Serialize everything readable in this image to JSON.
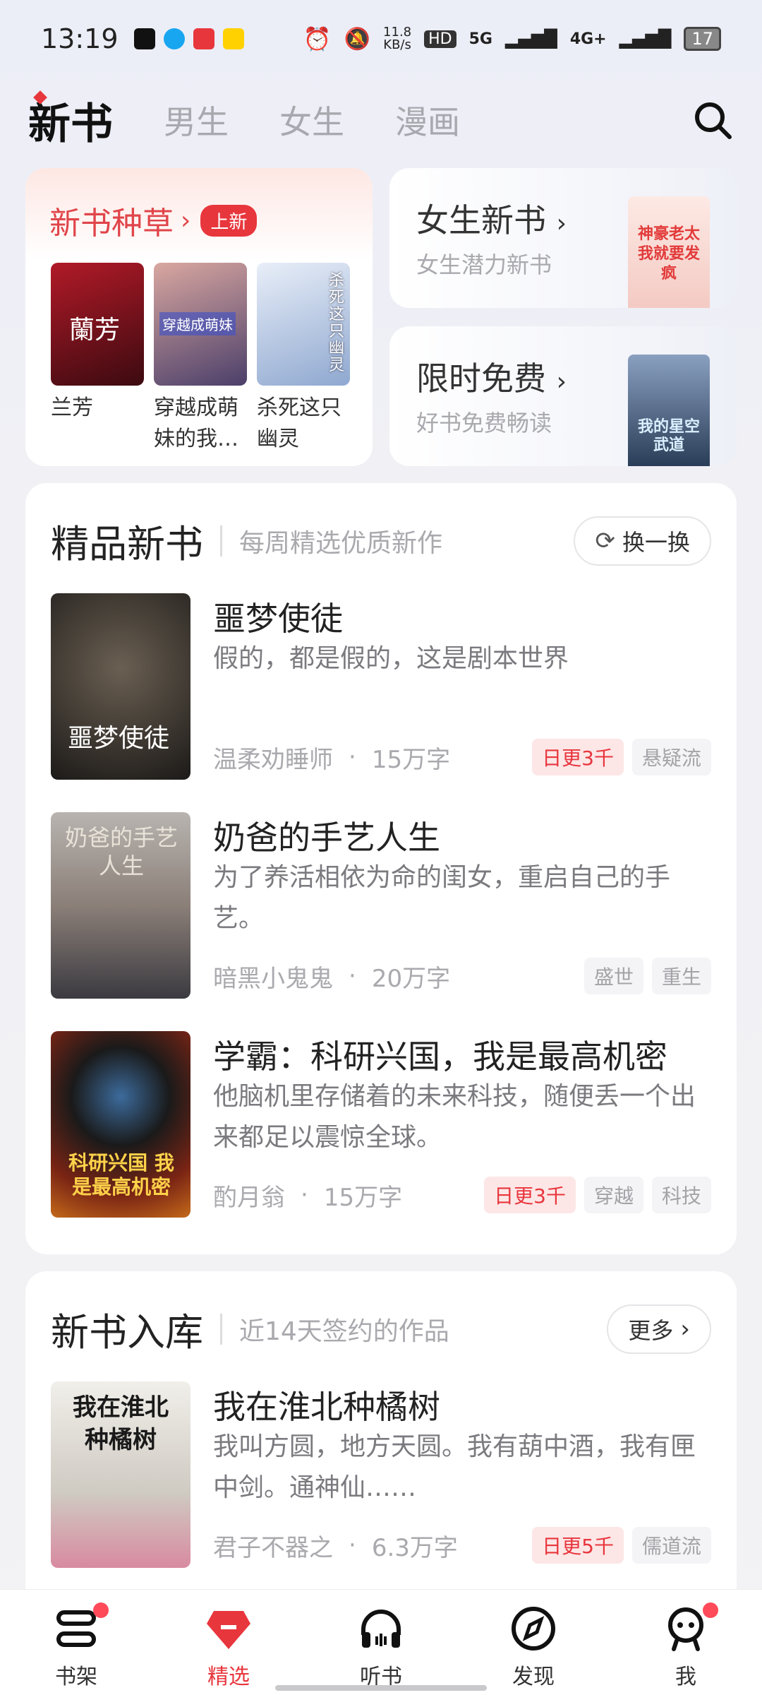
{
  "status_bar": {
    "time": "13:19",
    "net_speed": "11.8\nKB/s",
    "hd": "HD",
    "signal1": "5G",
    "signal2": "4G+",
    "battery": "17"
  },
  "top_nav": {
    "tabs": [
      "新书",
      "男生",
      "女生",
      "漫画"
    ],
    "active": "新书",
    "search_icon": "search-icon"
  },
  "promo_left": {
    "title": "新书种草",
    "badge": "上新",
    "books": [
      {
        "title": "兰芳",
        "cover_text": "蘭芳",
        "color": "#8b1420"
      },
      {
        "title": "穿越成萌妹的我…",
        "cover_text": "穿越成萌妹",
        "color": "#5a4a7a"
      },
      {
        "title": "杀死这只幽灵",
        "cover_text": "杀死这只幽灵",
        "color": "#9fb6d9"
      }
    ]
  },
  "promo_right": [
    {
      "title": "女生新书",
      "subtitle": "女生潜力新书",
      "cover_text": "神豪老太 我就要发疯",
      "color": "#f6d4cf"
    },
    {
      "title": "限时免费",
      "subtitle": "好书免费畅读",
      "cover_text": "我的星空武道",
      "color": "#3b4f73"
    }
  ],
  "premium": {
    "title": "精品新书",
    "subtitle": "每周精选优质新作",
    "refresh_label": "换一换",
    "books": [
      {
        "title": "噩梦使徒",
        "desc": "假的，都是假的，这是剧本世界",
        "author": "温柔劝睡师",
        "words": "15万字",
        "tags": [
          {
            "text": "日更3千",
            "hot": true
          },
          {
            "text": "悬疑流",
            "hot": false
          }
        ],
        "cover_text": "噩梦使徒",
        "color": "#3a3530"
      },
      {
        "title": "奶爸的手艺人生",
        "desc": "为了养活相依为命的闺女，重启自己的手艺。",
        "author": "暗黑小鬼鬼",
        "words": "20万字",
        "tags": [
          {
            "text": "盛世",
            "hot": false
          },
          {
            "text": "重生",
            "hot": false
          }
        ],
        "cover_text": "奶爸的手艺人生",
        "color": "#6e6a72"
      },
      {
        "title": "学霸：科研兴国，我是最高机密",
        "desc": "他脑机里存储着的未来科技，随便丢一个出来都足以震惊全球。",
        "author": "酌月翁",
        "words": "15万字",
        "tags": [
          {
            "text": "日更3千",
            "hot": true
          },
          {
            "text": "穿越",
            "hot": false
          },
          {
            "text": "科技",
            "hot": false
          }
        ],
        "cover_text": "科研兴国 我是最高机密",
        "color": "#5a1e14"
      }
    ]
  },
  "new_arrivals": {
    "title": "新书入库",
    "subtitle": "近14天签约的作品",
    "more_label": "更多",
    "books": [
      {
        "title": "我在淮北种橘树",
        "desc": "我叫方圆，地方天圆。我有葫中酒，我有匣中剑。通神仙……",
        "author": "君子不器之",
        "words": "6.3万字",
        "tags": [
          {
            "text": "日更5千",
            "hot": true
          },
          {
            "text": "儒道流",
            "hot": false
          }
        ],
        "cover_text": "我在淮北 种橘树",
        "color": "#d8d6d0"
      }
    ]
  },
  "bottom_nav": [
    {
      "label": "书架",
      "icon": "bookshelf-icon",
      "dot": true
    },
    {
      "label": "精选",
      "icon": "gem-icon",
      "active": true
    },
    {
      "label": "听书",
      "icon": "headphones-icon"
    },
    {
      "label": "发现",
      "icon": "compass-icon"
    },
    {
      "label": "我",
      "icon": "profile-icon",
      "dot": true
    }
  ],
  "colors": {
    "accent": "#e8363d",
    "muted": "#a9a9ae"
  }
}
